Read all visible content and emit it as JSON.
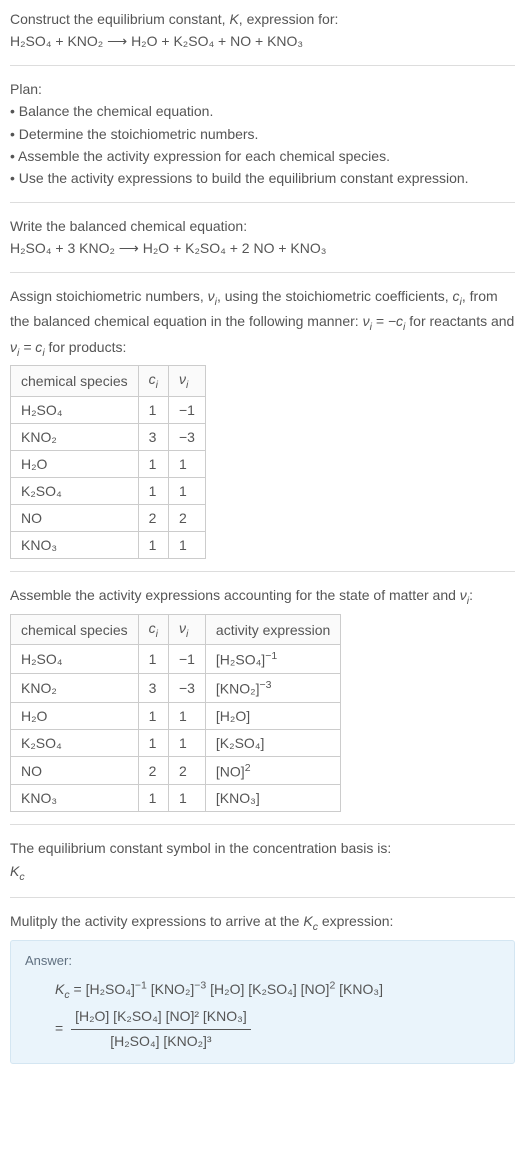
{
  "intro": {
    "title_a": "Construct the equilibrium constant, ",
    "title_b": ", expression for:",
    "eq": "H₂SO₄ + KNO₂ ⟶ H₂O + K₂SO₄ + NO + KNO₃"
  },
  "plan": {
    "label": "Plan:",
    "items": [
      "• Balance the chemical equation.",
      "• Determine the stoichiometric numbers.",
      "• Assemble the activity expression for each chemical species.",
      "• Use the activity expressions to build the equilibrium constant expression."
    ]
  },
  "balanced": {
    "label": "Write the balanced chemical equation:",
    "eq": "H₂SO₄ + 3 KNO₂ ⟶ H₂O + K₂SO₄ + 2 NO + KNO₃"
  },
  "stoich": {
    "text_a": "Assign stoichiometric numbers, ",
    "text_b": ", using the stoichiometric coefficients, ",
    "text_c": ", from the balanced chemical equation in the following manner: ",
    "text_d": " for reactants and ",
    "text_e": " for products:",
    "headers": [
      "chemical species",
      "cᵢ",
      "νᵢ"
    ],
    "rows": [
      [
        "H₂SO₄",
        "1",
        "−1"
      ],
      [
        "KNO₂",
        "3",
        "−3"
      ],
      [
        "H₂O",
        "1",
        "1"
      ],
      [
        "K₂SO₄",
        "1",
        "1"
      ],
      [
        "NO",
        "2",
        "2"
      ],
      [
        "KNO₃",
        "1",
        "1"
      ]
    ]
  },
  "activity": {
    "text_a": "Assemble the activity expressions accounting for the state of matter and ",
    "text_b": ":",
    "headers": [
      "chemical species",
      "cᵢ",
      "νᵢ",
      "activity expression"
    ],
    "rows": [
      {
        "sp": "H₂SO₄",
        "c": "1",
        "v": "−1",
        "act_base": "[H₂SO₄]",
        "act_exp": "−1"
      },
      {
        "sp": "KNO₂",
        "c": "3",
        "v": "−3",
        "act_base": "[KNO₂]",
        "act_exp": "−3"
      },
      {
        "sp": "H₂O",
        "c": "1",
        "v": "1",
        "act_base": "[H₂O]",
        "act_exp": ""
      },
      {
        "sp": "K₂SO₄",
        "c": "1",
        "v": "1",
        "act_base": "[K₂SO₄]",
        "act_exp": ""
      },
      {
        "sp": "NO",
        "c": "2",
        "v": "2",
        "act_base": "[NO]",
        "act_exp": "2"
      },
      {
        "sp": "KNO₃",
        "c": "1",
        "v": "1",
        "act_base": "[KNO₃]",
        "act_exp": ""
      }
    ]
  },
  "symbol": {
    "text": "The equilibrium constant symbol in the concentration basis is:",
    "sym": "K",
    "sub": "c"
  },
  "multiply": {
    "text_a": "Mulitply the activity expressions to arrive at the ",
    "text_b": " expression:"
  },
  "answer": {
    "label": "Answer:",
    "kc": "K",
    "kcsub": "c",
    "eq_sign": " = ",
    "t1": "[H₂SO₄]",
    "e1": "−1",
    "t2": "[KNO₂]",
    "e2": "−3",
    "t3": "[H₂O]",
    "t4": "[K₂SO₄]",
    "t5": "[NO]",
    "e5": "2",
    "t6": "[KNO₃]",
    "num": "[H₂O] [K₂SO₄] [NO]² [KNO₃]",
    "den": "[H₂SO₄] [KNO₂]³"
  },
  "chart_data": {
    "type": "table",
    "tables": [
      {
        "title": "stoichiometric numbers",
        "columns": [
          "chemical species",
          "c_i",
          "nu_i"
        ],
        "rows": [
          [
            "H2SO4",
            1,
            -1
          ],
          [
            "KNO2",
            3,
            -3
          ],
          [
            "H2O",
            1,
            1
          ],
          [
            "K2SO4",
            1,
            1
          ],
          [
            "NO",
            2,
            2
          ],
          [
            "KNO3",
            1,
            1
          ]
        ]
      },
      {
        "title": "activity expressions",
        "columns": [
          "chemical species",
          "c_i",
          "nu_i",
          "activity expression"
        ],
        "rows": [
          [
            "H2SO4",
            1,
            -1,
            "[H2SO4]^-1"
          ],
          [
            "KNO2",
            3,
            -3,
            "[KNO2]^-3"
          ],
          [
            "H2O",
            1,
            1,
            "[H2O]"
          ],
          [
            "K2SO4",
            1,
            1,
            "[K2SO4]"
          ],
          [
            "NO",
            2,
            2,
            "[NO]^2"
          ],
          [
            "KNO3",
            1,
            1,
            "[KNO3]"
          ]
        ]
      }
    ]
  }
}
